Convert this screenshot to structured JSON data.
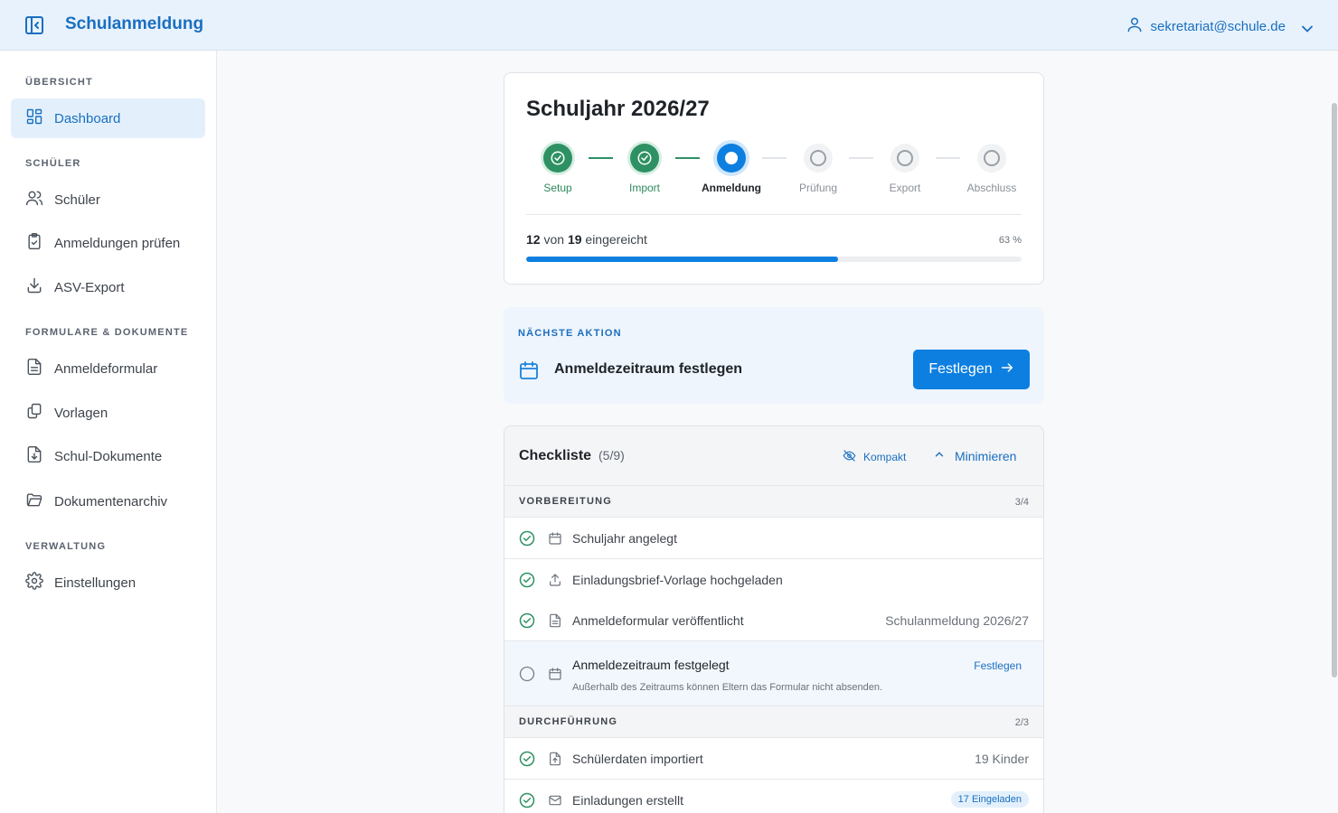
{
  "header": {
    "app_title": "Schulanmeldung",
    "user_email": "sekretariat@schule.de"
  },
  "sidebar": {
    "sections": [
      {
        "title": "ÜBERSICHT",
        "items": [
          {
            "label": "Dashboard",
            "icon": "dashboard-icon",
            "active": true
          }
        ]
      },
      {
        "title": "SCHÜLER",
        "items": [
          {
            "label": "Schüler",
            "icon": "users-icon"
          },
          {
            "label": "Anmeldungen prüfen",
            "icon": "clipboard-check-icon"
          },
          {
            "label": "ASV-Export",
            "icon": "download-icon"
          }
        ]
      },
      {
        "title": "FORMULARE & DOKUMENTE",
        "items": [
          {
            "label": "Anmeldeformular",
            "icon": "file-text-icon"
          },
          {
            "label": "Vorlagen",
            "icon": "copy-icon"
          },
          {
            "label": "Schul-Dokumente",
            "icon": "file-download-icon"
          },
          {
            "label": "Dokumentenarchiv",
            "icon": "folder-open-icon"
          }
        ]
      },
      {
        "title": "VERWALTUNG",
        "items": [
          {
            "label": "Einstellungen",
            "icon": "gear-icon"
          }
        ]
      }
    ]
  },
  "year_card": {
    "title": "Schuljahr 2026/27",
    "steps": [
      {
        "label": "Setup",
        "state": "done"
      },
      {
        "label": "Import",
        "state": "done"
      },
      {
        "label": "Anmeldung",
        "state": "current"
      },
      {
        "label": "Prüfung",
        "state": "todo"
      },
      {
        "label": "Export",
        "state": "todo"
      },
      {
        "label": "Abschluss",
        "state": "todo"
      }
    ],
    "progress": {
      "submitted": "12",
      "von": "von",
      "total": "19",
      "suffix": "eingereicht",
      "percent_label": "63 %",
      "fraction": 0.63
    }
  },
  "next_action": {
    "eyebrow": "NÄCHSTE AKTION",
    "title": "Anmeldezeitraum festlegen",
    "button": "Festlegen"
  },
  "checklist": {
    "title": "Checkliste",
    "count": "(5/9)",
    "compact_label": "Kompakt",
    "minimize_label": "Minimieren",
    "groups": [
      {
        "name": "VORBEREITUNG",
        "count": "3/4",
        "items": [
          {
            "text": "Schuljahr angelegt",
            "icon": "calendar-icon",
            "done": true,
            "right": ""
          },
          {
            "text": "Einladungsbrief-Vorlage hochgeladen",
            "icon": "upload-icon",
            "done": true,
            "right": ""
          },
          {
            "text": "Anmeldeformular veröffentlicht",
            "icon": "document-icon",
            "done": true,
            "right": "Schulanmeldung 2026/27"
          },
          {
            "text": "Anmeldezeitraum festgelegt",
            "icon": "calendar-icon",
            "done": false,
            "sub": "Außerhalb des Zeitraums können Eltern das Formular nicht absenden.",
            "link": "Festlegen"
          }
        ]
      },
      {
        "name": "DURCHFÜHRUNG",
        "count": "2/3",
        "items": [
          {
            "text": "Schülerdaten importiert",
            "icon": "file-upload-icon",
            "done": true,
            "right": "19 Kinder"
          },
          {
            "text": "Einladungen erstellt",
            "icon": "mail-icon",
            "done": true,
            "badge": "17 Eingeladen"
          }
        ]
      }
    ]
  }
}
